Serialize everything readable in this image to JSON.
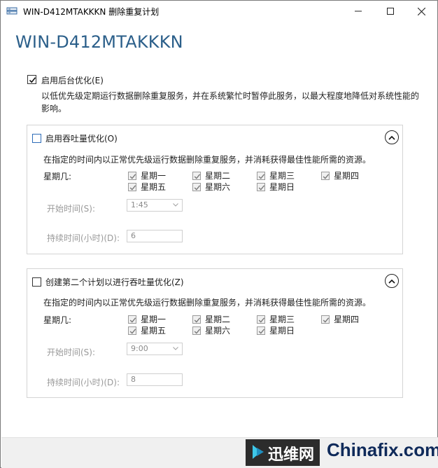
{
  "window": {
    "title": "WIN-D412MTAKKKN 删除重复计划",
    "header": "WIN-D412MTAKKKN"
  },
  "main": {
    "enable_background_label": "启用后台优化(E)",
    "enable_background_checked": true,
    "description": "以低优先级定期运行数据删除重复服务，并在系统繁忙时暂停此服务，以最大程度地降低对系统性能的影响。"
  },
  "panel1": {
    "checkbox_label": "启用吞吐量优化(O)",
    "checked": false,
    "description": "在指定的时间内以正常优先级运行数据删除重复服务，并消耗获得最佳性能所需的资源。",
    "weekday_label": "星期几:",
    "days": [
      "星期一",
      "星期二",
      "星期三",
      "星期四",
      "星期五",
      "星期六",
      "星期日"
    ],
    "start_time_label": "开始时间(S):",
    "start_time_value": "1:45",
    "duration_label": "持续时间(小时)(D):",
    "duration_value": "6"
  },
  "panel2": {
    "checkbox_label": "创建第二个计划以进行吞吐量优化(Z)",
    "checked": false,
    "description": "在指定的时间内以正常优先级运行数据删除重复服务，并消耗获得最佳性能所需的资源。",
    "weekday_label": "星期几:",
    "days": [
      "星期一",
      "星期二",
      "星期三",
      "星期四",
      "星期五",
      "星期六",
      "星期日"
    ],
    "start_time_label": "开始时间(S):",
    "start_time_value": "9:00",
    "duration_label": "持续时间(小时)(D):",
    "duration_value": "8"
  },
  "watermark": {
    "cn_text": "迅维网",
    "en_text": "Chinafix.com"
  },
  "colors": {
    "header_blue": "#2b5f8a",
    "checkbox_blue": "#2e6db8"
  },
  "icons": {
    "app": "server-icon",
    "minimize": "minimize-icon",
    "maximize": "maximize-icon",
    "close": "close-icon",
    "collapse": "chevron-up-icon"
  }
}
